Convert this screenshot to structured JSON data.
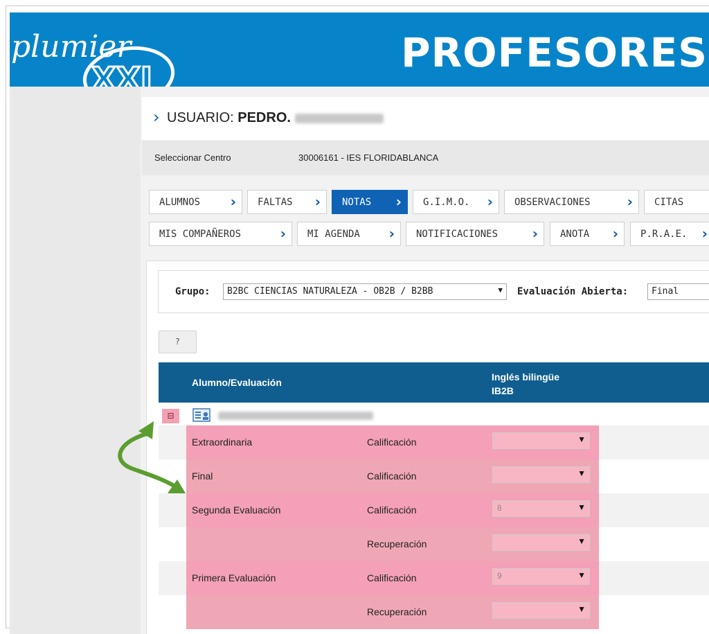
{
  "app": {
    "logo_text": "plumier XXI",
    "header_title": "PROFESORES"
  },
  "user": {
    "prefix": "USUARIO:",
    "name": "PEDRO."
  },
  "centro": {
    "label": "Seleccionar Centro",
    "value": "30006161 - IES FLORIDABLANCA"
  },
  "nav": {
    "row1": [
      {
        "label": "ALUMNOS"
      },
      {
        "label": "FALTAS"
      },
      {
        "label": "NOTAS",
        "active": true
      },
      {
        "label": "G.I.M.O."
      },
      {
        "label": "OBSERVACIONES"
      },
      {
        "label": "CITAS"
      }
    ],
    "row2": [
      {
        "label": "MIS COMPAÑEROS"
      },
      {
        "label": "MI AGENDA"
      },
      {
        "label": "NOTIFICACIONES"
      },
      {
        "label": "ANOTA"
      },
      {
        "label": "P.R.A.E."
      }
    ]
  },
  "filters": {
    "grupo_label": "Grupo:",
    "grupo_value": "B2BC CIENCIAS NATURALEZA - OB2B / B2BB",
    "evaluacion_label": "Evaluación Abierta:",
    "evaluacion_value": "Final"
  },
  "help_button": "?",
  "table": {
    "col_student": "Alumno/Evaluación",
    "col_subject_line1": "Inglés bilingüe",
    "col_subject_line2": "IB2B",
    "student_toggle": "⊟",
    "rows": [
      {
        "evaluation": "Extraordinaria",
        "type": "Calificación",
        "value": ""
      },
      {
        "evaluation": "Final",
        "type": "Calificación",
        "value": ""
      },
      {
        "evaluation": "Segunda Evaluación",
        "type": "Calificación",
        "value": "8"
      },
      {
        "evaluation": "",
        "type": "Recuperación",
        "value": ""
      },
      {
        "evaluation": "Primera Evaluación",
        "type": "Calificación",
        "value": "9"
      },
      {
        "evaluation": "",
        "type": "Recuperación",
        "value": ""
      }
    ]
  },
  "icons": {
    "tab_arrow": "chevron-right-icon",
    "student_card": "student-card-icon",
    "callout": "green-curved-arrow-icon"
  },
  "colors": {
    "header_blue": "#0784c9",
    "active_tab": "#0f62b4",
    "table_header": "#0f5e8f",
    "highlight_pink": "#f0a7b5",
    "callout_green": "#5a9e2f"
  }
}
